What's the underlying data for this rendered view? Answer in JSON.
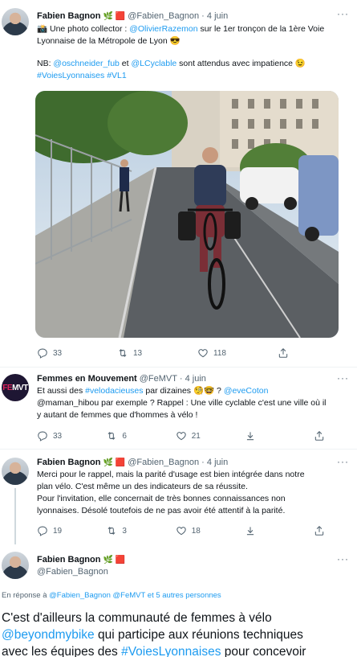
{
  "tweet1": {
    "name": "Fabien Bagnon",
    "badges": "🌿 🟥",
    "handle": "@Fabien_Bagnon",
    "sep": "·",
    "time": "4 juin",
    "text_emoji": "📸",
    "text_a": " Une photo collector : ",
    "mention1": "@OlivierRazemon",
    "text_b": " sur le 1er tronçon de la 1ère Voie Lyonnaise de la Métropole de Lyon ",
    "text_emoji2": "😎",
    "nb_a": "NB: ",
    "mention2": "@oschneider_fub",
    "nb_b": " et ",
    "mention3": "@LCyclable",
    "nb_c": " sont attendus avec impatience ",
    "nb_emoji": "😉",
    "hashtag1": "#VoiesLyonnaises",
    "hashtag2": "#VL1",
    "replies": "33",
    "retweets": "13",
    "likes": "118",
    "photo_alt": "Cycliste sur la piste cyclable"
  },
  "tweet2": {
    "name": "Femmes en Mouvement",
    "handle": "@FeMVT",
    "sep": "·",
    "time": "4 juin",
    "avatar_text_a": "FE",
    "avatar_text_b": "MVT",
    "l1_a": "Et aussi des ",
    "l1_hash": "#velodacieuses",
    "l1_b": " par dizaines ",
    "l1_emoji": "🧐🤓",
    "l1_c": " ? ",
    "l1_mention": "@eveCoton",
    "l2": "@maman_hibou par exemple ? Rappel : Une ville cyclable c'est une ville où il",
    "l3": "y autant de femmes que d'hommes à vélo !",
    "replies": "33",
    "retweets": "6",
    "likes": "21"
  },
  "tweet3": {
    "name": "Fabien Bagnon",
    "badges": "🌿 🟥",
    "handle": "@Fabien_Bagnon",
    "sep": "·",
    "time": "4 juin",
    "l1": "Merci pour le rappel, mais la parité d'usage est bien intégrée dans notre",
    "l2": "plan vélo. C'est même un des indicateurs de sa réussite.",
    "l3": "Pour l'invitation, elle concernait de très bonnes connaissances non",
    "l4": "lyonnaises. Désolé toutefois de ne pas avoir été attentif à la parité.",
    "replies": "19",
    "retweets": "3",
    "likes": "18"
  },
  "tweet4": {
    "name": "Fabien Bagnon",
    "badges": "🌿 🟥",
    "handle": "@Fabien_Bagnon",
    "reply_prefix": "En réponse à ",
    "reply_to": "@Fabien_Bagnon @FeMVT",
    "reply_suffix": " et 5 autres personnes",
    "l1": "C'est d'ailleurs la communauté de femmes à vélo",
    "l2_mention": "@beyondmybike",
    "l2_b": " qui participe aux réunions techniques",
    "l3_a": "avec les équipes des ",
    "l3_hash": "#VoiesLyonnaises",
    "l3_b": " pour concevoir"
  },
  "more_glyph": "···",
  "colors": {
    "link": "#1d9bf0",
    "muted": "#536471",
    "divider": "#eff3f4"
  },
  "icons": [
    "reply-icon",
    "retweet-icon",
    "like-icon",
    "share-icon",
    "more-icon"
  ]
}
